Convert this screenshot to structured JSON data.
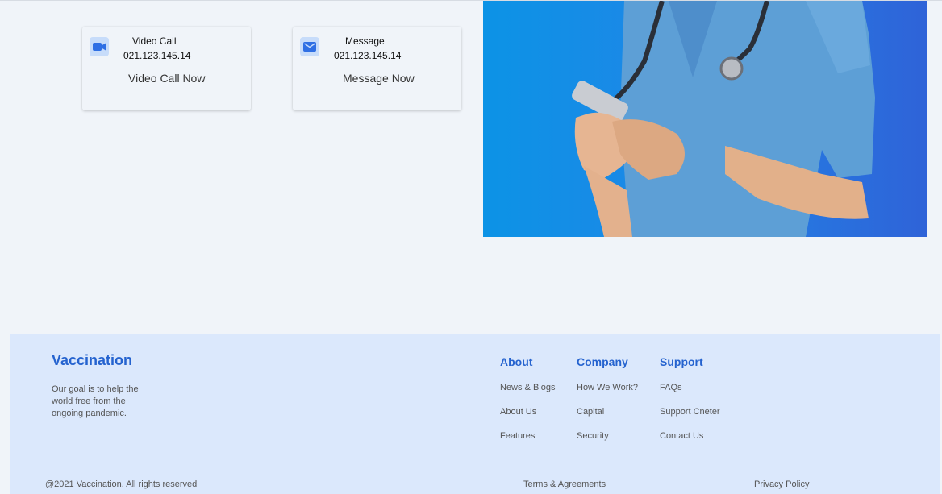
{
  "contact_cards": {
    "video": {
      "icon": "video-camera-icon",
      "title": "Video Call",
      "phone": "021.123.145.14",
      "cta": "Video Call Now"
    },
    "message": {
      "icon": "envelope-icon",
      "title": "Message",
      "phone": "021.123.145.14",
      "cta": "Message Now"
    }
  },
  "hero_image": {
    "subject": "nurse-with-phone-image"
  },
  "footer": {
    "brand": "Vaccination",
    "tagline": "Our goal is to help the world free from the ongoing pandemic.",
    "columns": [
      {
        "heading": "About",
        "links": [
          "News & Blogs",
          "About Us",
          "Features"
        ]
      },
      {
        "heading": "Company",
        "links": [
          "How We Work?",
          "Capital",
          "Security"
        ]
      },
      {
        "heading": "Support",
        "links": [
          "FAQs",
          "Support Cneter",
          "Contact Us"
        ]
      }
    ],
    "copyright": "@2021 Vaccination. All rights reserved",
    "terms": "Terms & Agreements",
    "privacy": "Privacy Policy"
  },
  "colors": {
    "accent": "#2563cf",
    "footer_bg": "#dbe8fc",
    "page_bg": "#f0f4f9"
  }
}
